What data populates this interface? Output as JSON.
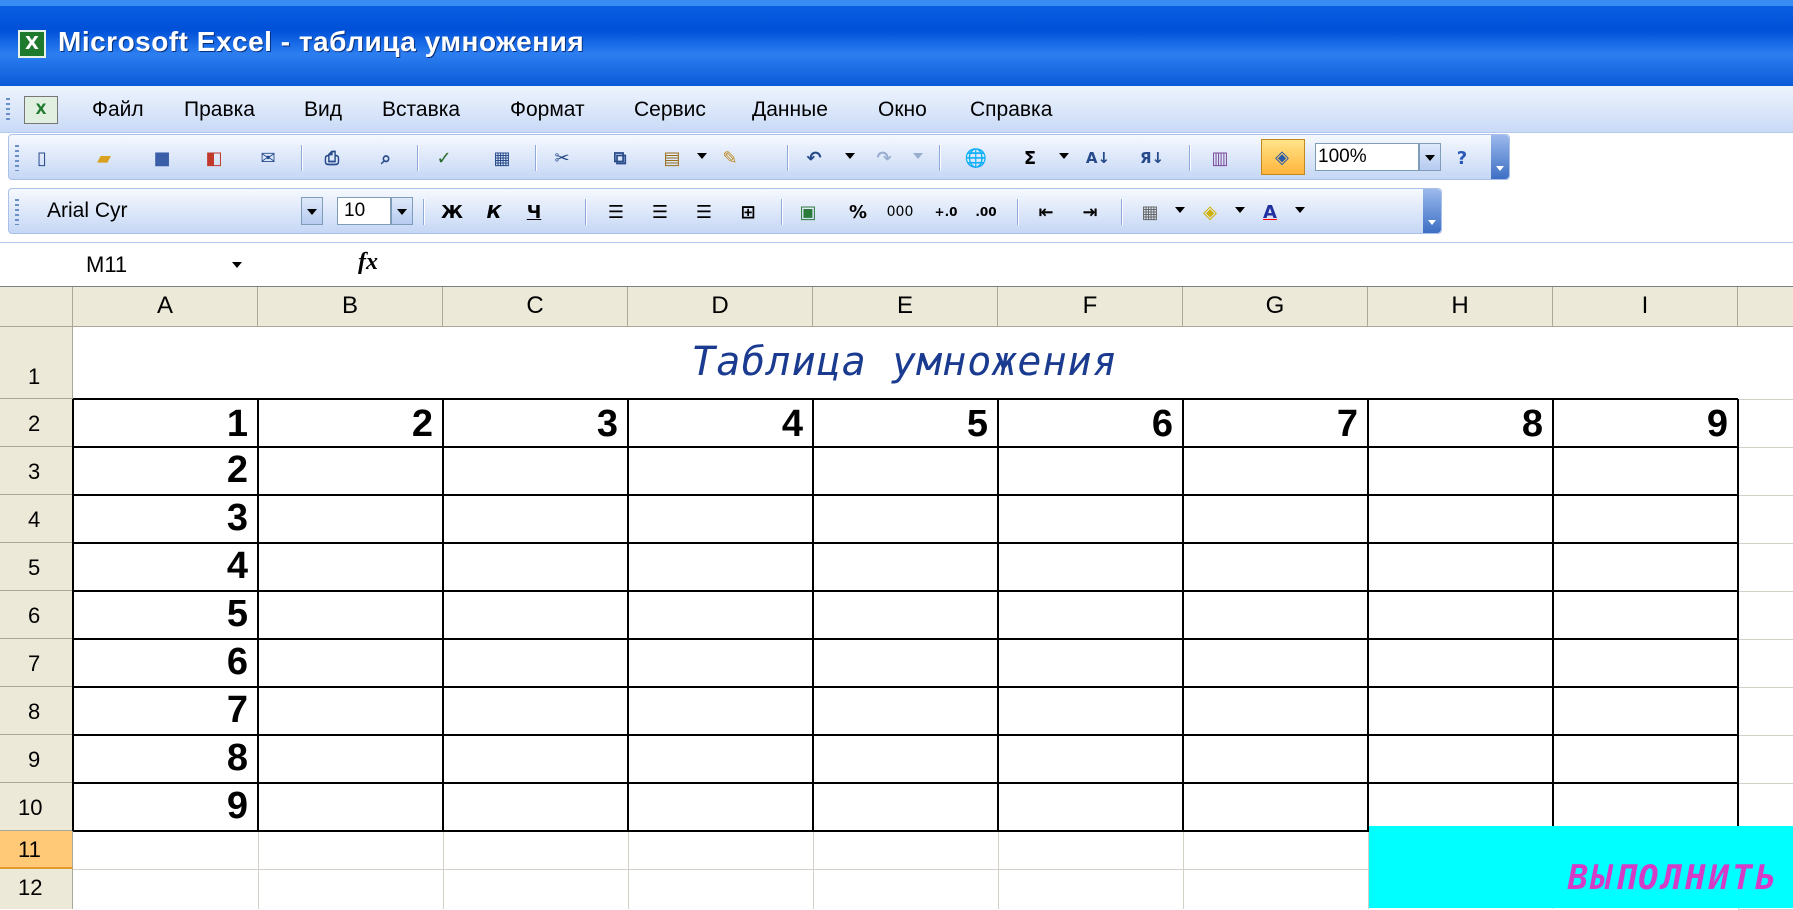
{
  "window": {
    "title": "Microsoft Excel - таблица умножения",
    "icon": "excel-icon"
  },
  "menu": [
    "Файл",
    "Правка",
    "Вид",
    "Вставка",
    "Формат",
    "Сервис",
    "Данные",
    "Окно",
    "Справка"
  ],
  "toolbar_standard": {
    "zoom": "100%"
  },
  "toolbar_format": {
    "font": "Arial Cyr",
    "size": "10",
    "bold": "Ж",
    "italic": "К",
    "underline": "Ч",
    "percent": "%",
    "thousands": "000"
  },
  "formula_bar": {
    "cell": "M11",
    "fx": "fx",
    "formula": ""
  },
  "columns": [
    "A",
    "B",
    "C",
    "D",
    "E",
    "F",
    "G",
    "H",
    "I"
  ],
  "rows": [
    "1",
    "2",
    "3",
    "4",
    "5",
    "6",
    "7",
    "8",
    "9",
    "10",
    "11",
    "12"
  ],
  "sheet": {
    "title": "Таблица умножения",
    "header_row": [
      "1",
      "2",
      "3",
      "4",
      "5",
      "6",
      "7",
      "8",
      "9"
    ],
    "header_col": [
      "2",
      "3",
      "4",
      "5",
      "6",
      "7",
      "8",
      "9"
    ]
  },
  "action_button": "ВЫПОЛНИТЬ",
  "colors": {
    "titlebar": "#0050d8",
    "selected_row": "#ffc977",
    "button_bg": "#00ffff",
    "button_text": "#d43cc8"
  }
}
